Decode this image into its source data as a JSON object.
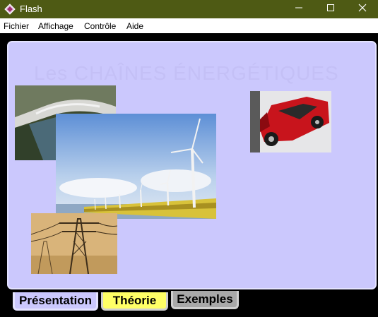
{
  "window": {
    "title": "Flash",
    "title_bar_color": "#4e5a14",
    "controls": [
      "minimize-icon",
      "maximize-icon",
      "close-icon"
    ]
  },
  "menu": {
    "items": [
      {
        "label": "Fichier"
      },
      {
        "label": "Affichage"
      },
      {
        "label": "Contrôle"
      },
      {
        "label": "Aide"
      }
    ]
  },
  "content": {
    "heading": "Les CHAÎNES ÉNERGÉTIQUES",
    "panel_color": "#cbc8fd",
    "images": [
      {
        "name": "dam-photo"
      },
      {
        "name": "wind-turbines-photo"
      },
      {
        "name": "power-pylon-photo"
      },
      {
        "name": "crashed-car-photo"
      }
    ]
  },
  "tabs": [
    {
      "label": "Présentation",
      "color": "#cbc8fd",
      "active": true
    },
    {
      "label": "Théorie",
      "color": "#ffff66",
      "active": false
    },
    {
      "label": "Exemples",
      "color": "#a8a8a8",
      "active": false
    }
  ]
}
